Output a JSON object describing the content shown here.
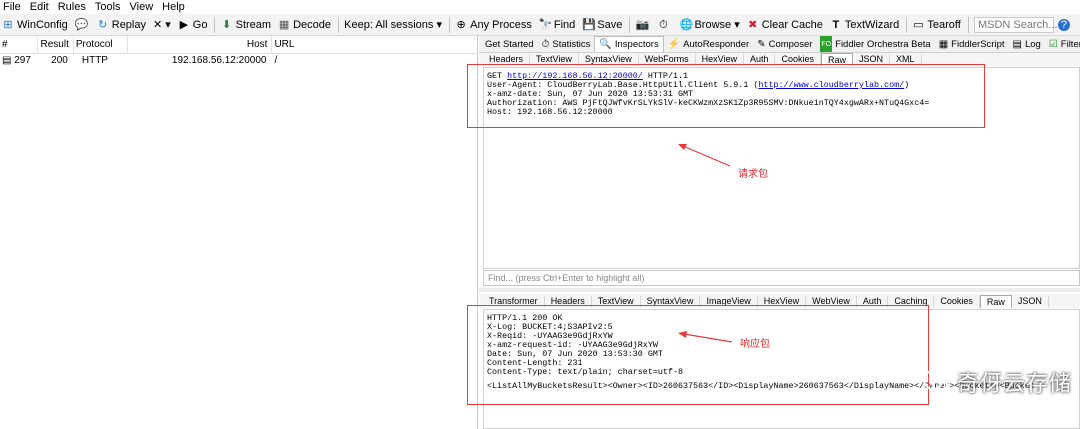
{
  "menu": [
    "File",
    "Edit",
    "Rules",
    "Tools",
    "View",
    "Help"
  ],
  "toolbar": {
    "winconfig": "WinConfig",
    "replay": "Replay",
    "remove": "✕ ▾",
    "go": "Go",
    "stream": "Stream",
    "decode": "Decode",
    "keep": "Keep: All sessions ▾",
    "any_process": "Any Process",
    "find": "Find",
    "save": "Save",
    "browse": "Browse ▾",
    "clear_cache": "Clear Cache",
    "textwizard": "TextWizard",
    "tearoff": "Tearoff",
    "msdn_search": "MSDN Search..."
  },
  "sessions": {
    "headers": [
      "#",
      "Result",
      "Protocol",
      "Host",
      "URL"
    ],
    "rows": [
      {
        "num": "297",
        "result": "200",
        "protocol": "HTTP",
        "host": "192.168.56.12:20000",
        "url": "/"
      }
    ]
  },
  "inspector_tabs": [
    {
      "label": "Get Started",
      "icon": ""
    },
    {
      "label": "Statistics",
      "icon": "⏱"
    },
    {
      "label": "Inspectors",
      "icon": "🔍"
    },
    {
      "label": "AutoResponder",
      "icon": "⚡"
    },
    {
      "label": "Composer",
      "icon": "✎"
    },
    {
      "label": "Fiddler Orchestra Beta",
      "icon": "FO"
    },
    {
      "label": "FiddlerScript",
      "icon": "▦"
    },
    {
      "label": "Log",
      "icon": "▤"
    },
    {
      "label": "Filters",
      "icon": "☑"
    }
  ],
  "request_tabs": [
    "Headers",
    "TextView",
    "SyntaxView",
    "WebForms",
    "HexView",
    "Auth",
    "Cookies",
    "Raw",
    "JSON",
    "XML"
  ],
  "request": {
    "line1_method": "GET ",
    "line1_url": "http://192.168.56.12:20000/",
    "line1_proto": " HTTP/1.1",
    "line2_prefix": "User-Agent: CloudBerryLab.Base.HttpUtil.Client 5.9.1 (",
    "line2_url": "http://www.cloudberrylab.com/",
    "line2_suffix": ")",
    "line3": "x-amz-date: Sun, 07 Jun 2020 13:53:31 GMT",
    "line4": "Authorization: AWS PjFtQJWfvKrSLYkSlV-keCKWzmXzSK1Zp3R95SMV:DNkue1nTQY4xgwARx+NTuQ4Gxc4=",
    "line5": "Host: 192.168.56.12:20000"
  },
  "find_placeholder": "Find... (press Ctrl+Enter to highlight all)",
  "response_tabs": [
    "Transformer",
    "Headers",
    "TextView",
    "SyntaxView",
    "ImageView",
    "HexView",
    "WebView",
    "Auth",
    "Caching",
    "Cookies",
    "Raw",
    "JSON"
  ],
  "response": {
    "lines": [
      "HTTP/1.1 200 OK",
      "X-Log: BUCKET:4;S3APIv2:5",
      "X-Reqid: -UYAAG3e9GdjRxYW",
      "x-amz-request-id: -UYAAG3e9GdjRxYW",
      "Date: Sun, 07 Jun 2020 13:53:30 GMT",
      "Content-Length: 231",
      "Content-Type: text/plain; charset=utf-8"
    ],
    "body": "<ListAllMyBucketsResult><Owner><ID>260637563</ID><DisplayName>260637563</DisplayName></Owner><Buckets><Bucket"
  },
  "annotations": {
    "request": "请求包",
    "response": "响应包"
  },
  "watermark": "奇伢云存储",
  "colors": {
    "annotation_red": "#e8393b",
    "link_blue": "#0000cc"
  }
}
